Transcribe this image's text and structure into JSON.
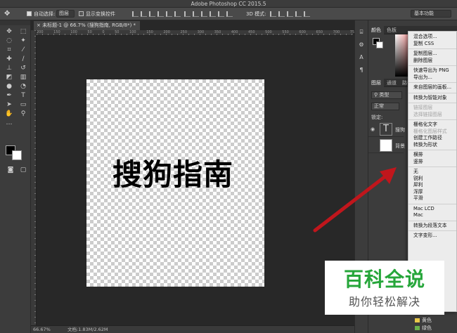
{
  "app_title": "Adobe Photoshop CC 2015.5",
  "options_bar": {
    "auto_select_label": "自动选择:",
    "auto_select_value": "图层",
    "show_transform_label": "显示变换控件",
    "mode_3d_label": "3D 模式:",
    "workspace": "基本功能"
  },
  "document": {
    "tab_title": "未标题-1 @ 66.7% (搜狗指南, RGB/8*) *",
    "ruler_numbers": "200 150 100 50 0 50 100 150 200 250 300 350 400 450 500 550 600 650 700 750 800",
    "canvas_text": "搜狗指南"
  },
  "status": {
    "zoom": "66.67%",
    "doc_size": "文档:1.83M/2.62M"
  },
  "color_panel": {
    "tabs": [
      "颜色",
      "色板"
    ]
  },
  "layers_panel": {
    "tabs": [
      "图层",
      "通道",
      "路径"
    ],
    "kind_label": "类型",
    "blend_mode": "正常",
    "lock_label": "锁定:",
    "layers": [
      {
        "name": "搜狗",
        "thumb": "T"
      },
      {
        "name": "背景",
        "thumb": ""
      }
    ]
  },
  "context_menu": {
    "items": [
      {
        "label": "混合选项...",
        "enabled": true
      },
      {
        "label": "复制 CSS",
        "enabled": true
      },
      {
        "sep": true
      },
      {
        "label": "复制图层...",
        "enabled": true
      },
      {
        "label": "删除图层",
        "enabled": true
      },
      {
        "sep": true
      },
      {
        "label": "快速导出为 PNG",
        "enabled": true
      },
      {
        "label": "导出为...",
        "enabled": true
      },
      {
        "sep": true
      },
      {
        "label": "来自图层的画板...",
        "enabled": true
      },
      {
        "sep": true
      },
      {
        "label": "转换为智能对象",
        "enabled": true
      },
      {
        "sep": true
      },
      {
        "label": "链接图层",
        "enabled": false
      },
      {
        "label": "选择链接图层",
        "enabled": false
      },
      {
        "sep": true
      },
      {
        "label": "栅格化文字",
        "enabled": true
      },
      {
        "label": "栅格化图层样式",
        "enabled": false
      },
      {
        "label": "创建工作路径",
        "enabled": true
      },
      {
        "label": "转换为形状",
        "enabled": true
      },
      {
        "sep": true
      },
      {
        "label": "横排",
        "enabled": true
      },
      {
        "label": "竖排",
        "enabled": true
      },
      {
        "sep": true
      },
      {
        "label": "无",
        "enabled": true
      },
      {
        "label": "锐利",
        "enabled": true
      },
      {
        "label": "犀利",
        "enabled": true
      },
      {
        "label": "浑厚",
        "enabled": true
      },
      {
        "label": "平滑",
        "enabled": true
      },
      {
        "sep": true
      },
      {
        "label": "Mac LCD",
        "enabled": true
      },
      {
        "label": "Mac",
        "enabled": true
      },
      {
        "sep": true
      },
      {
        "label": "转换为段落文本",
        "enabled": true
      },
      {
        "sep": true
      },
      {
        "label": "文字变形...",
        "enabled": true
      }
    ]
  },
  "swatches": [
    {
      "label": "黄色",
      "color": "#e8c84a"
    },
    {
      "label": "绿色",
      "color": "#6ab04c"
    }
  ],
  "watermark": {
    "title": "百科全说",
    "subtitle": "助你轻松解决"
  },
  "colors": {
    "arrow": "#c0161c",
    "watermark_green": "#26a63a"
  }
}
